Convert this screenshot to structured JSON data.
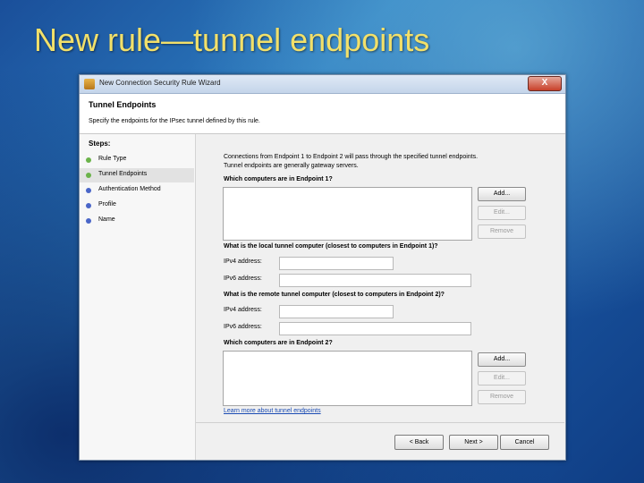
{
  "slide": {
    "title": "New rule—tunnel endpoints"
  },
  "window": {
    "title": "New Connection Security Rule Wizard",
    "close_glyph": "X"
  },
  "header": {
    "title": "Tunnel Endpoints",
    "description": "Specify the endpoints for the IPsec tunnel defined by this rule."
  },
  "steps": {
    "title": "Steps:",
    "items": [
      {
        "label": "Rule Type",
        "color": "#6bb34a",
        "active": false
      },
      {
        "label": "Tunnel Endpoints",
        "color": "#6bb34a",
        "active": true
      },
      {
        "label": "Authentication Method",
        "color": "#4a66c8",
        "active": false
      },
      {
        "label": "Profile",
        "color": "#4a66c8",
        "active": false
      },
      {
        "label": "Name",
        "color": "#4a66c8",
        "active": false
      }
    ]
  },
  "main": {
    "intro_line1": "Connections from Endpoint 1 to Endpoint 2 will pass through the specified tunnel endpoints.",
    "intro_line2": "Tunnel endpoints are generally gateway servers.",
    "endpoint1_question": "Which computers are in Endpoint 1?",
    "local_question": "What is the local tunnel computer (closest to computers in Endpoint 1)?",
    "remote_question": "What is the remote tunnel computer (closest to computers in Endpoint 2)?",
    "endpoint2_question": "Which computers are in Endpoint 2?",
    "ipv4_label": "IPv4 address:",
    "ipv6_label": "IPv6 address:",
    "local_ipv4_value": "",
    "local_ipv6_value": "",
    "remote_ipv4_value": "",
    "remote_ipv6_value": "",
    "add_label": "Add...",
    "edit_label": "Edit...",
    "remove_label": "Remove",
    "learn_more": "Learn more about tunnel endpoints"
  },
  "footer": {
    "back_label": "< Back",
    "next_label": "Next >",
    "cancel_label": "Cancel"
  }
}
